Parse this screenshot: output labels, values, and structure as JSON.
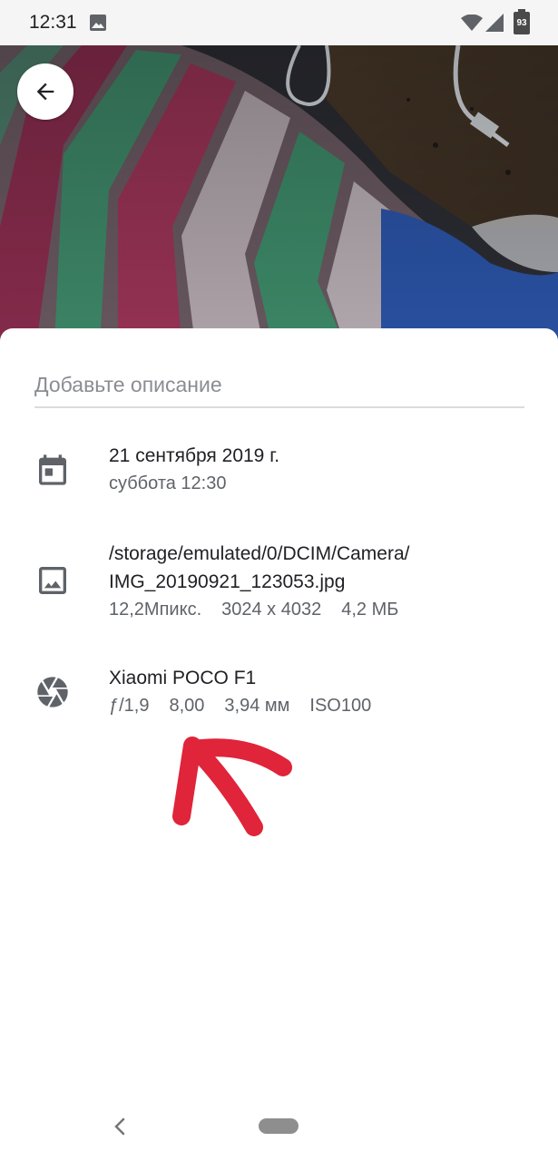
{
  "status_bar": {
    "time": "12:31",
    "battery": "93",
    "icons": [
      "image-icon",
      "wifi-icon",
      "signal-icon",
      "battery-icon"
    ]
  },
  "photo": {
    "description": "photo"
  },
  "description_input": {
    "placeholder": "Добавьте описание",
    "value": ""
  },
  "details": {
    "date": {
      "icon": "calendar-icon",
      "primary": "21 сентября 2019 г.",
      "secondary": "суббота 12:30"
    },
    "file": {
      "icon": "image-icon",
      "path_line1": "/storage/emulated/0/DCIM/Camera/",
      "path_line2": "IMG_20190921_123053.jpg",
      "megapixels": "12,2Мпикс.",
      "resolution": "3024 x 4032",
      "size": "4,2 МБ"
    },
    "camera": {
      "icon": "aperture-icon",
      "model": "Xiaomi POCO F1",
      "aperture": "ƒ/1,9",
      "exposure": "8,00",
      "focal_length": "3,94 мм",
      "iso": "ISO100"
    }
  },
  "colors": {
    "annotation": "#e0243a",
    "icon": "#5f6368",
    "text_primary": "#202124",
    "text_secondary": "#5f6368"
  }
}
